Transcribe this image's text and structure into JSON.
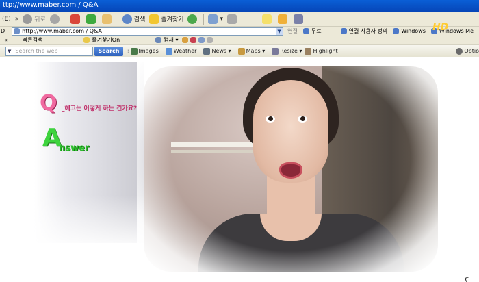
{
  "window": {
    "title": "ttp://www.maber.com / Q&A"
  },
  "toolbar": {
    "menu_fragment": "(E)",
    "chevron": "»",
    "back": "뒤로",
    "search": "검색",
    "favorites": "즐겨찾기"
  },
  "address": {
    "label": "D",
    "url": "http://www.maber.com / Q&A",
    "go_label": "연결",
    "links": [
      "무료",
      "연결 사용자 정의",
      "Windows",
      "Windows Me"
    ]
  },
  "favbar": {
    "quick_search": "빠른검색",
    "favorites_on": "즐겨찾기On",
    "tools": "컴채",
    "chevron": "«"
  },
  "searchbar": {
    "placeholder": "Search the web",
    "button": "Search",
    "items": [
      "Images",
      "Weather",
      "News",
      "Maps",
      "Resize",
      "Highlight"
    ],
    "options": "Optio"
  },
  "content": {
    "q_letter": "Q",
    "q_text": "_헤고는 어떻게 하는 건가요?",
    "a_letter": "A",
    "a_text": "nswer",
    "hd_logo": "HD"
  },
  "colors": {
    "titlebar": "#0646b8",
    "chrome": "#ece9d8",
    "search_button": "#2f62bd",
    "q_pink": "#f06aa0",
    "a_green": "#3ed33e"
  }
}
